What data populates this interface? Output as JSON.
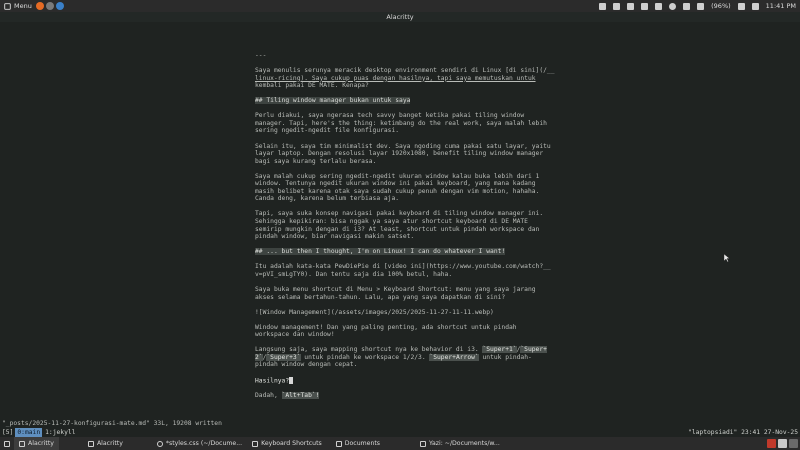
{
  "top_panel": {
    "menu_label": "Menu",
    "battery": "(96%)",
    "clock": "11:41 PM",
    "colors": {
      "firefox": "#e66b24",
      "app2": "#7a7a7a",
      "app3": "#3a80c8"
    }
  },
  "window": {
    "title": "Alacritty"
  },
  "document": {
    "separator": "---",
    "p1": [
      "Saya menulis serunya meracik desktop environment sendiri di Linux [di sini](/__",
      "linux-ricing). Saya cukup puas dengan hasilnya, tapi saya memutuskan untuk",
      "kembali pakai DE MATE. Kenapa?"
    ],
    "h1": "## Tiling window manager bukan untuk saya",
    "p2": [
      "Perlu diakui, saya ngerasa tech savvy banget ketika pakai tiling window",
      "manager. Tapi, here's the thing: ketimbang do the real work, saya malah lebih",
      "sering ngedit-ngedit file konfigurasi."
    ],
    "p3": [
      "Selain itu, saya tim minimalist dev. Saya ngoding cuma pakai satu layar, yaitu",
      "layar laptop. Dengan resolusi layar 1920x1080, benefit tiling window manager",
      "bagi saya kurang terlalu berasa."
    ],
    "p4": [
      "Saya malah cukup sering ngedit-ngedit ukuran window kalau buka lebih dari 1",
      "window. Tentunya ngedit ukuran window ini pakai keyboard, yang mana kadang",
      "masih belibet karena otak saya sudah cukup penuh dengan vim motion, hahaha.",
      "Canda deng, karena belum terbiasa aja."
    ],
    "p5": [
      "Tapi, saya suka konsep navigasi pakai keyboard di tiling window manager ini.",
      "Sehingga kepikiran: bisa nggak ya saya atur shortcut keyboard di DE MATE",
      "semirip mungkin dengan di i3? At least, shortcut untuk pindah workspace dan",
      "pindah window, biar navigasi makin satset."
    ],
    "h2": "## ... but then I thought, I'm on Linux! I can do whatever I want!",
    "p6": [
      "Itu adalah kata-kata PewDiePie di [video ini](https://www.youtube.com/watch?__",
      "v=pVI_smLgTY0). Dan tentu saja dia 100% betul, haha."
    ],
    "p7": [
      "Saya buka menu shortcut di Menu > Keyboard Shortcut: menu yang saya jarang",
      "akses selama bertahun-tahun. Lalu, apa yang saya dapatkan di sini?"
    ],
    "p8": "![Window Management](/assets/images/2025/2025-11-27-11-11.webp)",
    "p9": [
      "Window management! Dan yang paling penting, ada shortcut untuk pindah",
      "workspace dan window!"
    ],
    "p10": {
      "l1_a": "Langsung saja, saya mapping shortcut nya ke behavior di i3. ",
      "k1": "`Super+1`",
      "l1_b": "/",
      "k2": "`Super+",
      "l2_a": "2`",
      "l2_b": "/",
      "k3": "`Super+3`",
      "l2_c": " untuk pindah ke workspace 1/2/3. ",
      "k4": "`Super+Arrow`",
      "l2_d": " untuk pindah-",
      "l3": "pindah window dengan cepat."
    },
    "p11": "Hasilnya?",
    "p12_a": "Dadah, ",
    "p12_k": "`Alt+Tab`!"
  },
  "status_line": "\"_posts/2025-11-27-konfigurasi-mate.md\" 33L, 19208 written",
  "tmux": {
    "session": "[5]",
    "window0": "0:main",
    "window1": "1:jekyll",
    "right": "\"laptopsiadi\" 23:41 27-Nov-25"
  },
  "taskbar": {
    "tasks": [
      {
        "label": "Alacritty"
      },
      {
        "label": "Alacritty"
      },
      {
        "label": "*styles.css (~/Docume..."
      },
      {
        "label": "Keyboard Shortcuts"
      },
      {
        "label": "Documents"
      },
      {
        "label": "Yazi: ~/Documents/w..."
      }
    ],
    "colors": {
      "tray1": "#c0392b",
      "tray2": "#c9c9c9",
      "tray3": "#6a6a6a"
    }
  }
}
